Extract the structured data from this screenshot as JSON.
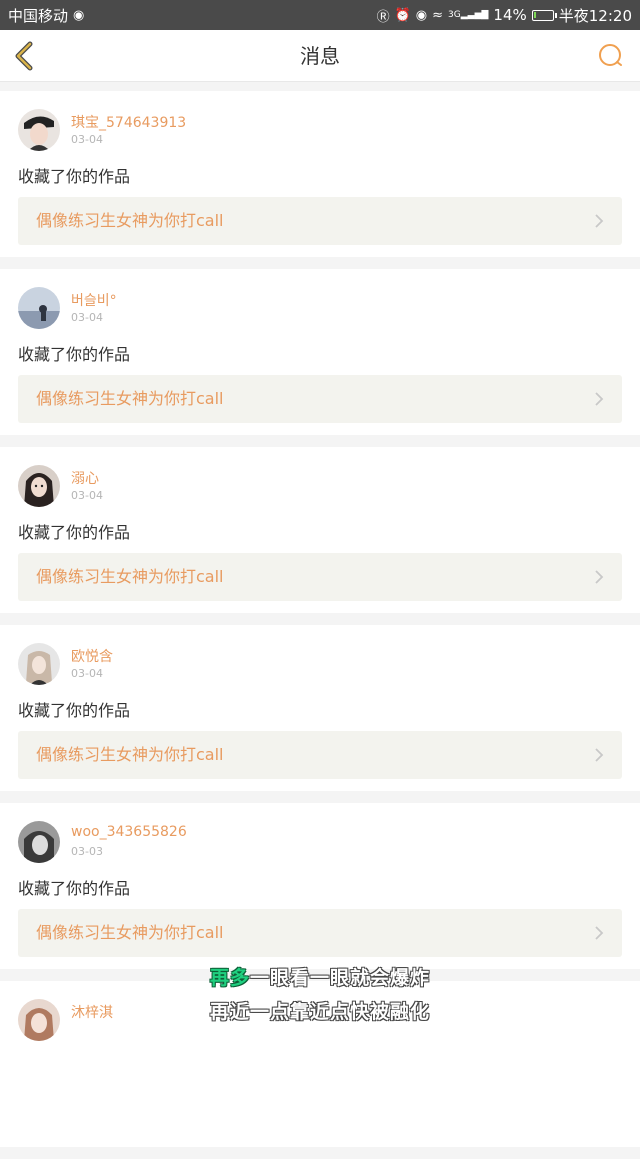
{
  "status_bar": {
    "carrier": "中国移动",
    "signal_label": "3G",
    "battery": "14%",
    "battery_level": 0.14,
    "time": "半夜12:20"
  },
  "nav": {
    "title": "消息",
    "back_icon": "chevron-left-icon",
    "search_icon": "search-icon",
    "accent_color": "#e89b60"
  },
  "messages": [
    {
      "user": "琪宝_574643913",
      "date": "03-04",
      "action": "收藏了你的作品",
      "work": "偶像练习生女神为你打call"
    },
    {
      "user": "버슬비°",
      "date": "03-04",
      "action": "收藏了你的作品",
      "work": "偶像练习生女神为你打call"
    },
    {
      "user": "溺心",
      "date": "03-04",
      "action": "收藏了你的作品",
      "work": "偶像练习生女神为你打call"
    },
    {
      "user": "欧悦含",
      "date": "03-04",
      "action": "收藏了你的作品",
      "work": "偶像练习生女神为你打call"
    },
    {
      "user": "woo_343655826",
      "date": "03-03",
      "action": "收藏了你的作品",
      "work": "偶像练习生女神为你打call"
    },
    {
      "user": "沐梓淇",
      "date": "",
      "action": "",
      "work": ""
    }
  ],
  "lyrics": {
    "line1_highlight": "再多",
    "line1_rest": "一眼看一眼就会爆炸",
    "line2": "再近一点靠近点快被融化"
  }
}
